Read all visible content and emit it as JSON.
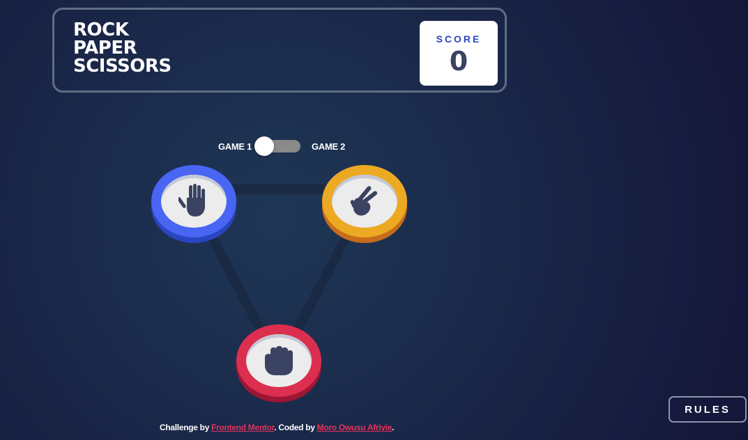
{
  "header": {
    "title_lines": [
      "ROCK",
      "PAPER",
      "SCISSORS"
    ],
    "score_label": "SCORE",
    "score_value": "0"
  },
  "mode_toggle": {
    "left_label": "GAME 1",
    "right_label": "GAME 2",
    "selected": "GAME 1"
  },
  "choices": [
    {
      "id": "paper",
      "icon": "paper-hand-icon",
      "color": "#4865f4"
    },
    {
      "id": "scissors",
      "icon": "scissors-hand-icon",
      "color": "#eca922"
    },
    {
      "id": "rock",
      "icon": "rock-fist-icon",
      "color": "#dc2e4e"
    }
  ],
  "rules_button": {
    "label": "RULES"
  },
  "attribution": {
    "prefix": "Challenge by ",
    "link1": "Frontend Mentor",
    "middle": ". Coded by ",
    "link2": "Moro Owusu Afriyie",
    "suffix": "."
  },
  "colors": {
    "background_inner": "#1f3756",
    "background_outer": "#141539",
    "header_outline": "#606e85",
    "score_text": "#2a46c0",
    "dark_text": "#3b4363",
    "link": "#e1325b"
  }
}
